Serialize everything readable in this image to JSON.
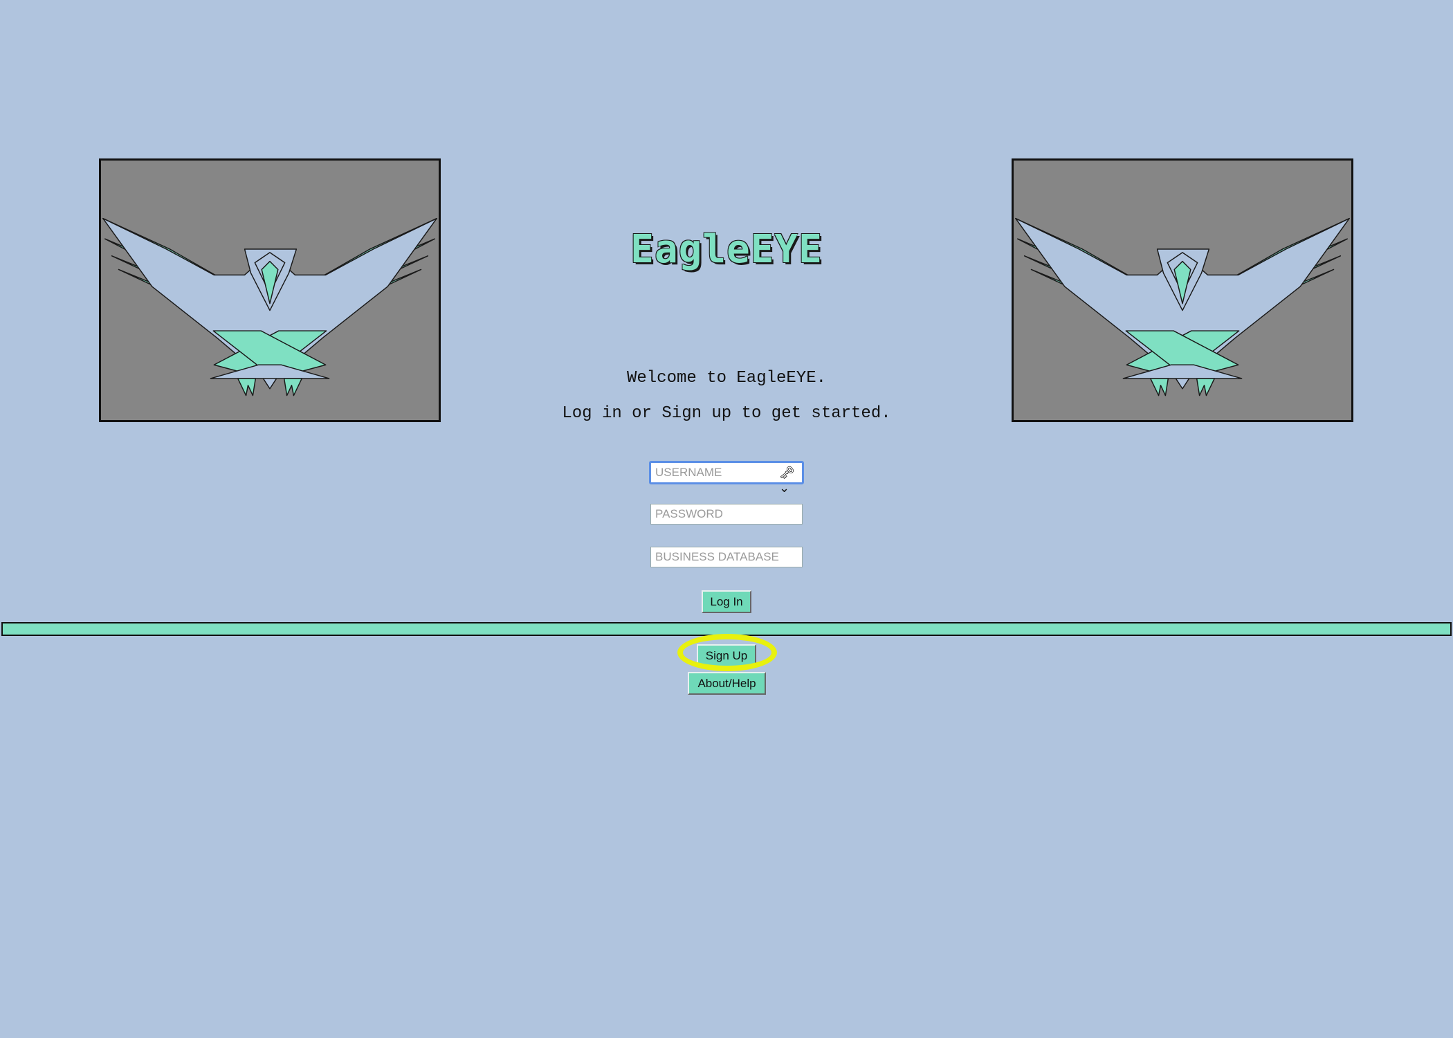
{
  "app": {
    "title": "EagleEYE",
    "welcome": "Welcome to EagleEYE.",
    "subtitle": "Log in or Sign up to get started."
  },
  "form": {
    "username": {
      "placeholder": "USERNAME",
      "value": ""
    },
    "password": {
      "placeholder": "PASSWORD",
      "value": ""
    },
    "database": {
      "placeholder": "BUSINESS DATABASE",
      "value": ""
    },
    "key_icon": "key-icon"
  },
  "buttons": {
    "login": "Log In",
    "signup": "Sign Up",
    "about": "About/Help"
  },
  "images": {
    "left": "eagle-logo",
    "right": "eagle-logo"
  },
  "colors": {
    "background": "#b0c4de",
    "accent": "#7fe0c2",
    "frame": "#868686",
    "highlight": "#e8f10e",
    "focus": "#5b8fe6"
  }
}
